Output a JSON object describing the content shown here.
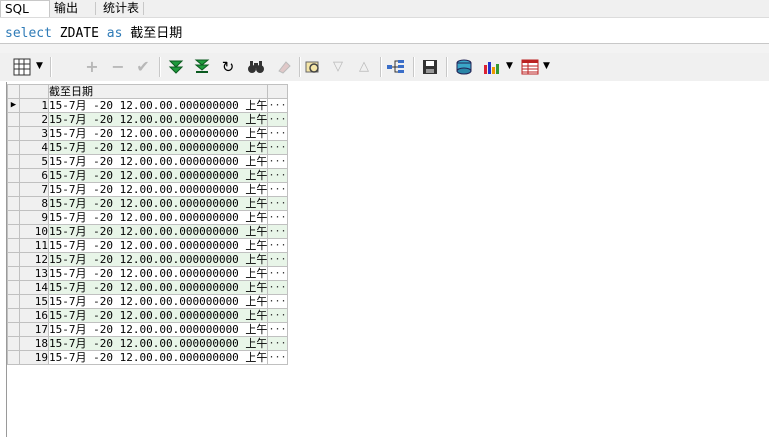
{
  "tabs": [
    "SQL",
    "输出",
    "统计表"
  ],
  "editor": {
    "kw_select": "select",
    "column": "ZDATE",
    "kw_as": "as",
    "alias": "截至日期"
  },
  "toolbar": {
    "buttons": [
      "grid-view-icon",
      "add-record-icon",
      "delete-record-icon",
      "post-edit-icon",
      "next-page-icon",
      "last-page-icon",
      "refresh-icon",
      "find-icon",
      "clear-icon",
      "query-by-example-icon",
      "filter-icon",
      "sort-icon",
      "tree-icon",
      "save-icon",
      "export-icon",
      "chart-icon",
      "table-options-icon"
    ]
  },
  "grid": {
    "header": "截至日期",
    "rows": [
      {
        "n": "1",
        "value": "15-7月 -20 12.00.00.000000000 上午"
      },
      {
        "n": "2",
        "value": "15-7月 -20 12.00.00.000000000 上午"
      },
      {
        "n": "3",
        "value": "15-7月 -20 12.00.00.000000000 上午"
      },
      {
        "n": "4",
        "value": "15-7月 -20 12.00.00.000000000 上午"
      },
      {
        "n": "5",
        "value": "15-7月 -20 12.00.00.000000000 上午"
      },
      {
        "n": "6",
        "value": "15-7月 -20 12.00.00.000000000 上午"
      },
      {
        "n": "7",
        "value": "15-7月 -20 12.00.00.000000000 上午"
      },
      {
        "n": "8",
        "value": "15-7月 -20 12.00.00.000000000 上午"
      },
      {
        "n": "9",
        "value": "15-7月 -20 12.00.00.000000000 上午"
      },
      {
        "n": "10",
        "value": "15-7月 -20 12.00.00.000000000 上午"
      },
      {
        "n": "11",
        "value": "15-7月 -20 12.00.00.000000000 上午"
      },
      {
        "n": "12",
        "value": "15-7月 -20 12.00.00.000000000 上午"
      },
      {
        "n": "13",
        "value": "15-7月 -20 12.00.00.000000000 上午"
      },
      {
        "n": "14",
        "value": "15-7月 -20 12.00.00.000000000 上午"
      },
      {
        "n": "15",
        "value": "15-7月 -20 12.00.00.000000000 上午"
      },
      {
        "n": "16",
        "value": "15-7月 -20 12.00.00.000000000 上午"
      },
      {
        "n": "17",
        "value": "15-7月 -20 12.00.00.000000000 上午"
      },
      {
        "n": "18",
        "value": "15-7月 -20 12.00.00.000000000 上午"
      },
      {
        "n": "19",
        "value": "15-7月 -20 12.00.00.000000000 上午"
      }
    ],
    "cell_button": "···"
  }
}
